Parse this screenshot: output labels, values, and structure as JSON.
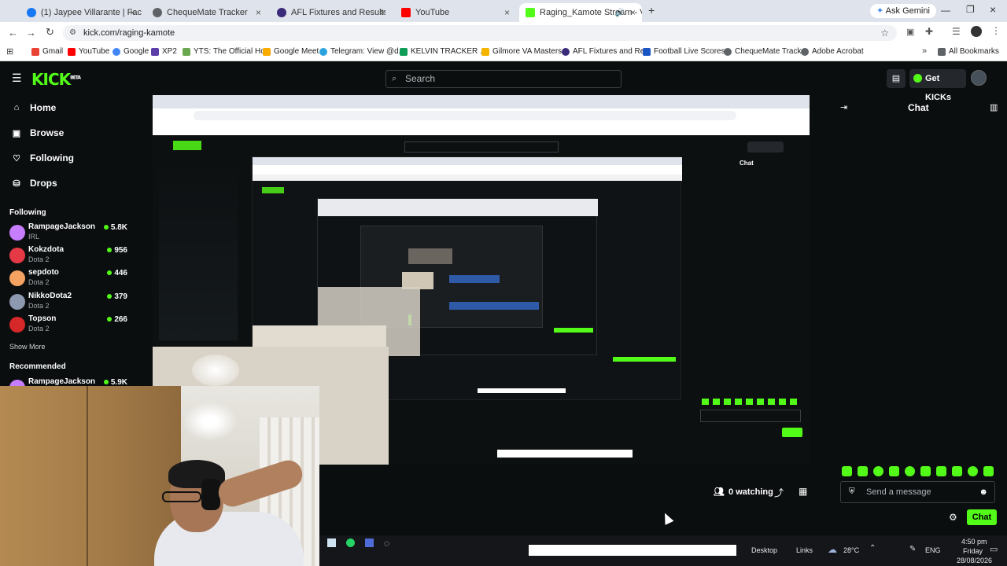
{
  "browser": {
    "tabs": [
      {
        "label": "(1) Jaypee Villarante | Facebook",
        "color": "#1877f2"
      },
      {
        "label": "ChequeMate Tracker",
        "color": "#5f6368"
      },
      {
        "label": "AFL Fixtures and Results - AFL.c",
        "color": "#3a2a7a"
      },
      {
        "label": "YouTube",
        "color": "#ff0000"
      },
      {
        "label": "Raging_Kamote Stream - V",
        "color": "#53fc18"
      }
    ],
    "new_tab": "+",
    "ask_gemini": "Ask Gemini",
    "url": "kick.com/raging-kamote",
    "bookmarks": [
      {
        "label": "Gmail",
        "color": "#ea4335"
      },
      {
        "label": "YouTube",
        "color": "#ff0000"
      },
      {
        "label": "Google",
        "color": "#4285f4"
      },
      {
        "label": "XP2",
        "color": "#5b3ea8"
      },
      {
        "label": "YTS: The Official Ho...",
        "color": "#6aa84f"
      },
      {
        "label": "Google Meet",
        "color": "#f9ab00"
      },
      {
        "label": "Telegram: View @d...",
        "color": "#2aa3df"
      },
      {
        "label": "KELVIN TRACKER ...",
        "color": "#0f9d58"
      },
      {
        "label": "Gilmore VA Masters...",
        "color": "#f4b400"
      },
      {
        "label": "AFL Fixtures and Re...",
        "color": "#3a2a7a"
      },
      {
        "label": "Football Live Scores...",
        "color": "#1a56c4"
      },
      {
        "label": "ChequeMate Tracker",
        "color": "#5f6368"
      },
      {
        "label": "Adobe Acrobat",
        "color": "#5f6368"
      }
    ],
    "all_bookmarks": "All Bookmarks"
  },
  "kick": {
    "logo": "KICK",
    "logo_sup": "BETA",
    "search_placeholder": "Search",
    "get_kicks": "Get KICKs",
    "nav": [
      {
        "label": "Home",
        "icon": "home-icon"
      },
      {
        "label": "Browse",
        "icon": "browse-icon"
      },
      {
        "label": "Following",
        "icon": "heart-icon"
      },
      {
        "label": "Drops",
        "icon": "drops-icon"
      }
    ],
    "following_title": "Following",
    "following": [
      {
        "name": "RampageJackson",
        "category": "IRL",
        "viewers": "5.8K",
        "color": "#c77dff"
      },
      {
        "name": "Kokzdota",
        "category": "Dota 2",
        "viewers": "956",
        "color": "#e63946"
      },
      {
        "name": "sepdoto",
        "category": "Dota 2",
        "viewers": "446",
        "color": "#f4a261"
      },
      {
        "name": "NikkoDota2",
        "category": "Dota 2",
        "viewers": "379",
        "color": "#8d99ae"
      },
      {
        "name": "Topson",
        "category": "Dota 2",
        "viewers": "266",
        "color": "#d62828"
      }
    ],
    "show_more": "Show More",
    "recommended_title": "Recommended",
    "recommended": [
      {
        "name": "RampageJackson",
        "viewers": "5.9K"
      }
    ]
  },
  "chat": {
    "title": "Chat",
    "placeholder": "Send a message",
    "send_label": "Chat"
  },
  "player": {
    "watching": "0 watching"
  },
  "taskbar": {
    "desktop": "Desktop",
    "links": "Links",
    "temp": "28°C",
    "lang": "ENG",
    "time": "4:50 pm",
    "day": "Friday",
    "date": "28/08/2026"
  },
  "colors": {
    "kick_green": "#53fc18",
    "bg": "#0b0e0f"
  }
}
